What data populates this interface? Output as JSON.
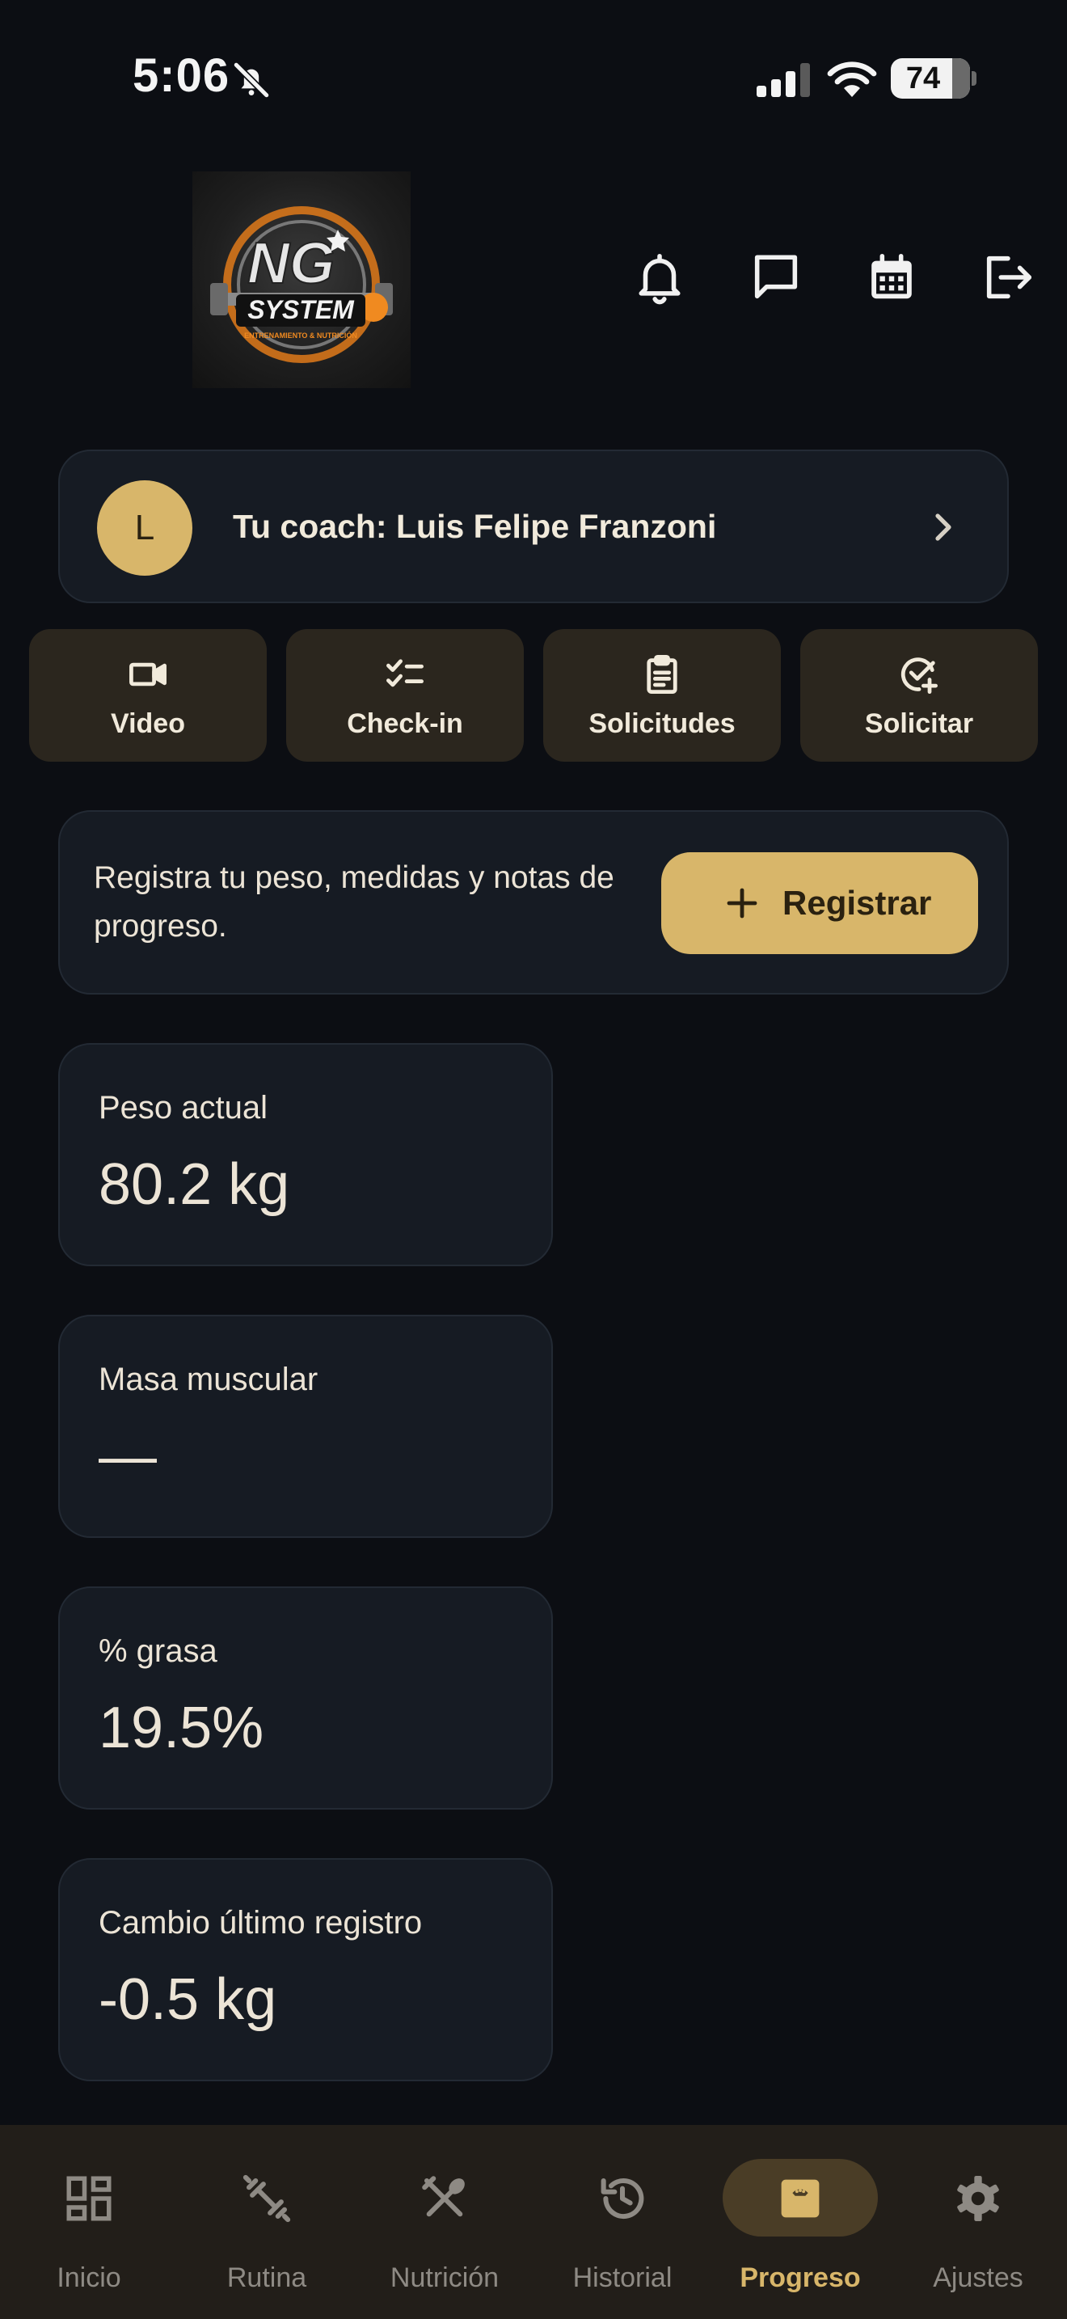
{
  "status_bar": {
    "time": "5:06",
    "battery": "74",
    "icons": [
      "bell-off-icon",
      "cellular-signal-icon",
      "wifi-icon",
      "battery-icon"
    ]
  },
  "header": {
    "logo": {
      "text": "NG SYSTEM",
      "subtitle": "ENTRENAMIENTO & NUTRICIÓN"
    },
    "actions": [
      {
        "name": "notifications",
        "icon": "bell-icon"
      },
      {
        "name": "messages",
        "icon": "chat-icon"
      },
      {
        "name": "calendar",
        "icon": "calendar-icon"
      },
      {
        "name": "logout",
        "icon": "logout-icon"
      }
    ]
  },
  "coach": {
    "avatar_initial": "L",
    "label": "Tu coach: Luis Felipe Franzoni"
  },
  "quick_actions": [
    {
      "label": "Video",
      "icon": "video-camera-icon"
    },
    {
      "label": "Check-in",
      "icon": "checklist-icon"
    },
    {
      "label": "Solicitudes",
      "icon": "clipboard-icon"
    },
    {
      "label": "Solicitar",
      "icon": "check-circle-plus-icon"
    }
  ],
  "register": {
    "text": "Registra tu peso, medidas y notas de progreso.",
    "button_label": "Registrar"
  },
  "stats": [
    {
      "label": "Peso actual",
      "value": "80.2 kg"
    },
    {
      "label": "Masa muscular",
      "value": "—"
    },
    {
      "label": "% grasa",
      "value": "19.5%"
    },
    {
      "label": "Cambio último registro",
      "value": "-0.5 kg"
    }
  ],
  "bottom_nav": {
    "active": "Progreso",
    "items": [
      {
        "label": "Inicio",
        "icon": "dashboard-icon"
      },
      {
        "label": "Rutina",
        "icon": "dumbbell-icon"
      },
      {
        "label": "Nutrición",
        "icon": "utensils-icon"
      },
      {
        "label": "Historial",
        "icon": "history-icon"
      },
      {
        "label": "Progreso",
        "icon": "scale-icon"
      },
      {
        "label": "Ajustes",
        "icon": "gear-icon"
      }
    ]
  },
  "colors": {
    "background": "#0c0e13",
    "card": "#161b23",
    "accent": "#d8b66a",
    "quick_action_bg": "#2b261e",
    "nav_bg": "#221e19",
    "text": "#ece4d6",
    "muted": "#8e8a84"
  }
}
